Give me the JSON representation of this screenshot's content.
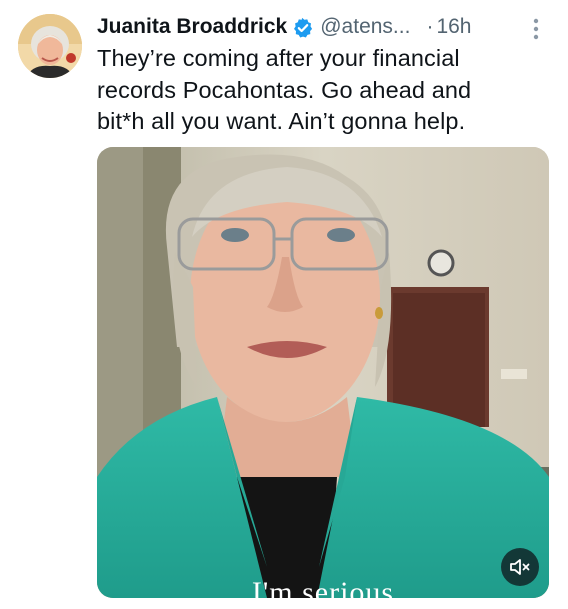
{
  "tweet": {
    "display_name": "Juanita Broaddrick",
    "handle": "@atens...",
    "separator": "·",
    "time": "16h",
    "text": "They’re coming after your financial\nrecords Pocahontas.  Go ahead and\nbit*h  all you want.  Ain’t gonna help.",
    "verified": true
  },
  "media": {
    "caption": "I'm serious",
    "audio_state": "muted",
    "mute_icon": "speaker-muted-icon"
  },
  "colors": {
    "text_primary": "#0f1419",
    "text_secondary": "#536471",
    "verified_blue": "#1d9bf0",
    "jacket": "#2fb3a0"
  },
  "icons": {
    "verified": "verified-badge-icon",
    "more": "more-options-icon"
  }
}
